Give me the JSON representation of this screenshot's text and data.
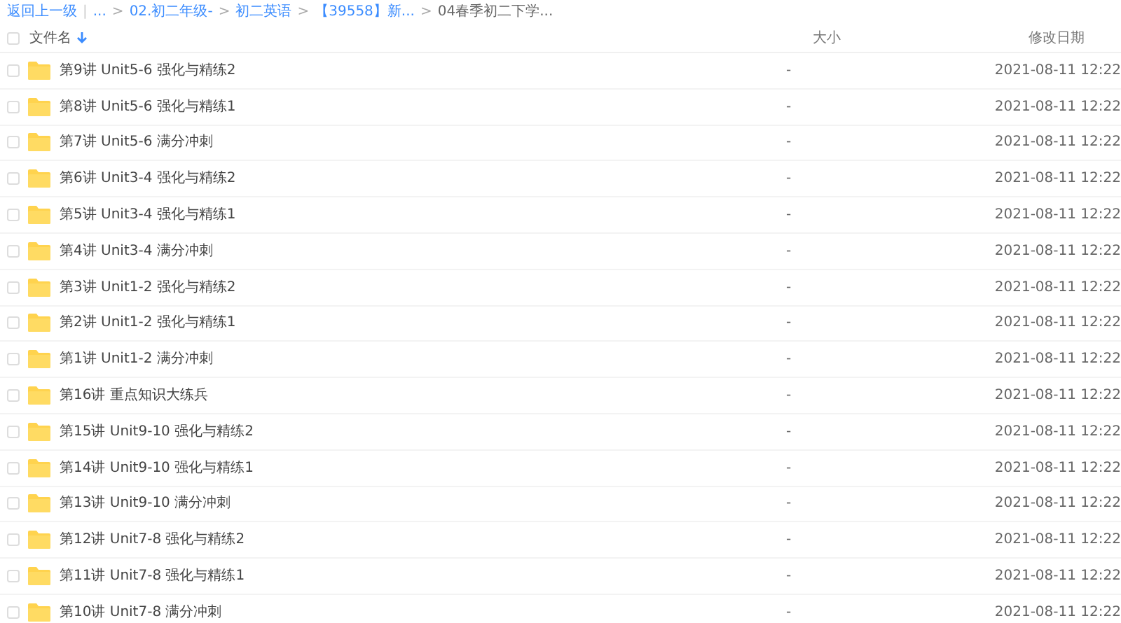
{
  "breadcrumb": {
    "back": "返回上一级",
    "separator": "|",
    "items": [
      {
        "label": "...",
        "current": false
      },
      {
        "chevron": ">",
        "label": "02.初二年级-",
        "current": false
      },
      {
        "chevron": ">",
        "label": "初二英语",
        "current": false
      },
      {
        "chevron": ">",
        "label": "【39558】新...",
        "current": false
      },
      {
        "chevron": ">",
        "label": "04春季初二下学...",
        "current": true
      }
    ]
  },
  "table": {
    "select_all_checked": false,
    "columns": [
      {
        "label": "文件名",
        "sorted": true
      },
      {
        "label": "大小",
        "sorted": false
      },
      {
        "label": "修改日期",
        "sorted": false
      }
    ],
    "rows": [
      {
        "name": "第9讲 Unit5-6 强化与精练2",
        "size": "-",
        "date": "2021-08-11 12:22",
        "checked": false
      },
      {
        "name": "第8讲 Unit5-6 强化与精练1",
        "size": "-",
        "date": "2021-08-11 12:22",
        "checked": false
      },
      {
        "name": "第7讲 Unit5-6 满分冲刺",
        "size": "-",
        "date": "2021-08-11 12:22",
        "checked": false
      },
      {
        "name": "第6讲 Unit3-4 强化与精练2",
        "size": "-",
        "date": "2021-08-11 12:22",
        "checked": false
      },
      {
        "name": "第5讲 Unit3-4 强化与精练1",
        "size": "-",
        "date": "2021-08-11 12:22",
        "checked": false
      },
      {
        "name": "第4讲 Unit3-4 满分冲刺",
        "size": "-",
        "date": "2021-08-11 12:22",
        "checked": false
      },
      {
        "name": "第3讲 Unit1-2 强化与精练2",
        "size": "-",
        "date": "2021-08-11 12:22",
        "checked": false
      },
      {
        "name": "第2讲 Unit1-2 强化与精练1",
        "size": "-",
        "date": "2021-08-11 12:22",
        "checked": false
      },
      {
        "name": "第1讲 Unit1-2 满分冲刺",
        "size": "-",
        "date": "2021-08-11 12:22",
        "checked": false
      },
      {
        "name": "第16讲 重点知识大练兵",
        "size": "-",
        "date": "2021-08-11 12:22",
        "checked": false
      },
      {
        "name": "第15讲 Unit9-10 强化与精练2",
        "size": "-",
        "date": "2021-08-11 12:22",
        "checked": false
      },
      {
        "name": "第14讲 Unit9-10 强化与精练1",
        "size": "-",
        "date": "2021-08-11 12:22",
        "checked": false
      },
      {
        "name": "第13讲 Unit9-10 满分冲刺",
        "size": "-",
        "date": "2021-08-11 12:22",
        "checked": false
      },
      {
        "name": "第12讲 Unit7-8 强化与精练2",
        "size": "-",
        "date": "2021-08-11 12:22",
        "checked": false
      },
      {
        "name": "第11讲 Unit7-8 强化与精练1",
        "size": "-",
        "date": "2021-08-11 12:22",
        "checked": false
      },
      {
        "name": "第10讲 Unit7-8 满分冲刺",
        "size": "-",
        "date": "2021-08-11 12:22",
        "checked": false
      }
    ]
  }
}
